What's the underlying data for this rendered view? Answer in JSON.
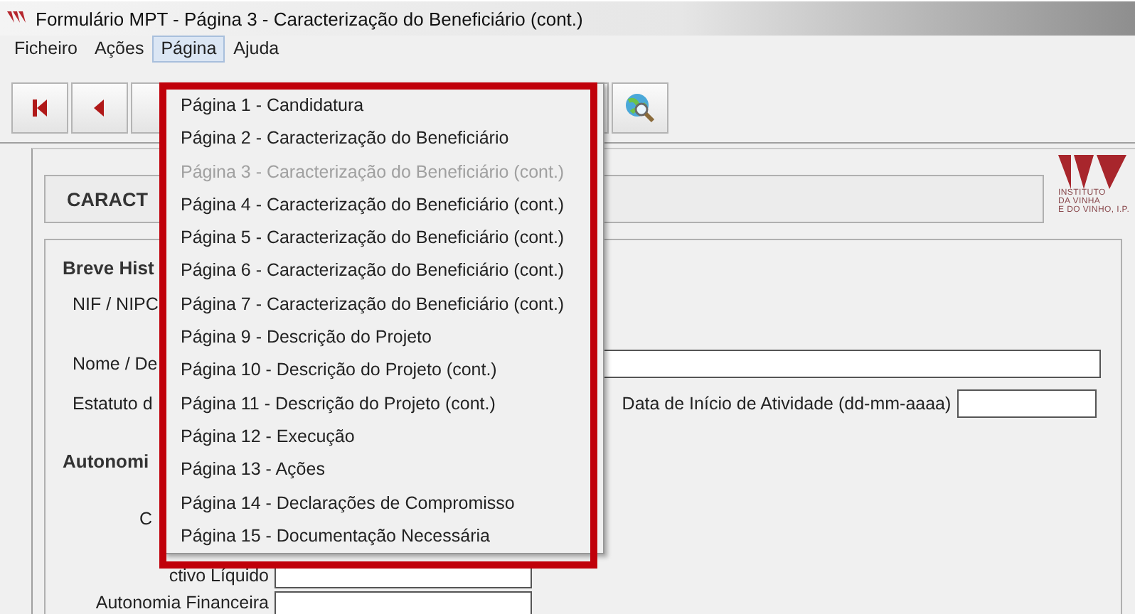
{
  "window": {
    "title": "Formulário MPT - Página 3 - Caracterização do Beneficiário (cont.)"
  },
  "menu_bar": [
    {
      "label": "Ficheiro",
      "selected": false
    },
    {
      "label": "Ações",
      "selected": false
    },
    {
      "label": "Página",
      "selected": true
    },
    {
      "label": "Ajuda",
      "selected": false
    }
  ],
  "toolbar": [
    {
      "kind": "first"
    },
    {
      "kind": "previous"
    },
    {
      "kind": "plain"
    },
    {
      "kind": "spacer"
    },
    {
      "kind": "plain"
    },
    {
      "kind": "search"
    }
  ],
  "page_menu": {
    "items": [
      {
        "label": "Página 1 - Candidatura",
        "disabled": false
      },
      {
        "label": "Página 2 - Caracterização do Beneficiário",
        "disabled": false
      },
      {
        "label": "Página 3 - Caracterização do Beneficiário (cont.)",
        "disabled": true
      },
      {
        "label": "Página 4 - Caracterização do Beneficiário (cont.)",
        "disabled": false
      },
      {
        "label": "Página 5 - Caracterização do Beneficiário (cont.)",
        "disabled": false
      },
      {
        "label": "Página 6 - Caracterização do Beneficiário (cont.)",
        "disabled": false
      },
      {
        "label": "Página 7 - Caracterização do Beneficiário (cont.)",
        "disabled": false
      },
      {
        "label": "Página 9 - Descrição do Projeto",
        "disabled": false
      },
      {
        "label": "Página 10 - Descrição do Projeto (cont.)",
        "disabled": false
      },
      {
        "label": "Página 11 - Descrição do Projeto (cont.)",
        "disabled": false
      },
      {
        "label": "Página 12 - Execução",
        "disabled": false
      },
      {
        "label": "Página 13 - Ações",
        "disabled": false
      },
      {
        "label": "Página 14 - Declarações de Compromisso",
        "disabled": false
      },
      {
        "label": "Página 15 - Documentação Necessária",
        "disabled": false
      }
    ]
  },
  "header": {
    "title": "CARACT"
  },
  "logo": {
    "lines": [
      "INSTITUTO",
      "DA VINHA",
      "E DO VINHO, I.P."
    ]
  },
  "form": {
    "sections": [
      {
        "title": "Breve Hist",
        "rows": [
          {
            "kind": "label",
            "label": "NIF / NIPC"
          },
          {
            "kind": "wide",
            "label": "Nome / De"
          },
          {
            "kind": "date",
            "label": "Estatuto d",
            "label_2": "Data de Início de Atividade (dd-mm-aaaa)"
          }
        ]
      },
      {
        "title": "Autonomi",
        "rows": [
          {
            "kind": "short",
            "label": "C"
          },
          {
            "kind": "field",
            "label": "ctivo Líquido"
          },
          {
            "kind": "field",
            "label": "Autonomia Financeira"
          }
        ]
      }
    ]
  }
}
